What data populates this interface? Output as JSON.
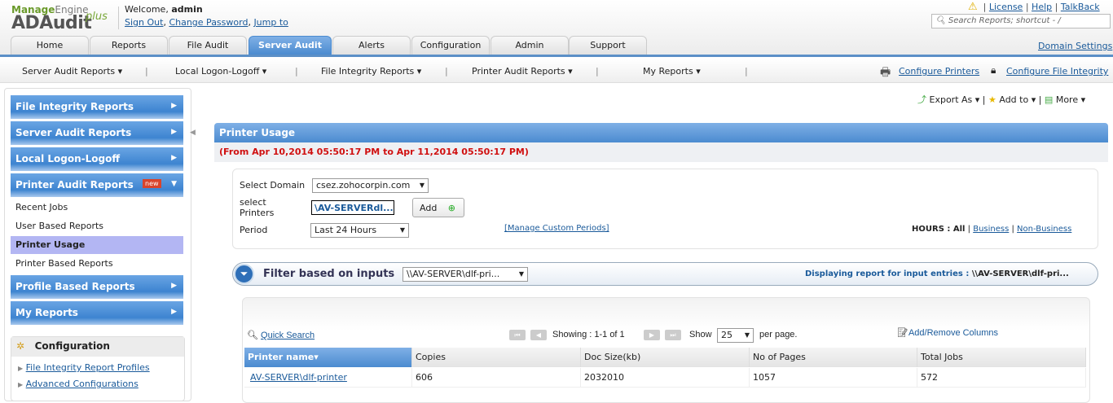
{
  "header": {
    "brand_top_a": "Manage",
    "brand_top_b": "Engine",
    "brand_main": "ADAudit",
    "brand_plus": "plus",
    "welcome_prefix": "Welcome, ",
    "user": "admin",
    "sign_out": "Sign Out",
    "change_password": "Change Password",
    "jump_to": "Jump to",
    "license": "License",
    "help": "Help",
    "talkback": "TalkBack",
    "search_placeholder": "Search Reports; shortcut - /",
    "domain_settings": "Domain Settings"
  },
  "tabs": [
    "Home",
    "Reports",
    "File Audit",
    "Server Audit",
    "Alerts",
    "Configuration",
    "Admin",
    "Support"
  ],
  "subnav": {
    "items": [
      "Server Audit Reports ▾",
      "Local Logon-Logoff ▾",
      "File Integrity Reports ▾",
      "Printer Audit Reports ▾",
      "My Reports ▾"
    ],
    "configure_printers": "Configure Printers",
    "configure_file_integrity": "Configure File Integrity"
  },
  "sidebar": {
    "sections": [
      "File Integrity Reports",
      "Server Audit Reports",
      "Local Logon-Logoff",
      "Printer Audit Reports",
      "Profile Based Reports",
      "My Reports"
    ],
    "new_badge": "new",
    "sub_items": [
      "Recent Jobs",
      "User Based Reports",
      "Printer Usage",
      "Printer Based Reports"
    ],
    "config_title": "Configuration",
    "config_links": [
      "File Integrity Report Profiles",
      "Advanced Configurations"
    ]
  },
  "toolbar": {
    "export": "Export As ▾",
    "add_to": "Add to ▾",
    "more": "More ▾"
  },
  "report": {
    "title": "Printer Usage",
    "date_range": "(From Apr 10,2014 05:50:17 PM to Apr 11,2014 05:50:17 PM)",
    "domain_label": "Select Domain",
    "domain_value": "csez.zohocorpin.com",
    "printers_label": "select Printers",
    "printers_value": "\\AV-SERVERdl...",
    "add_button": "Add",
    "period_label": "Period",
    "period_value": "Last 24 Hours",
    "manage_periods": "[Manage Custom Periods]",
    "hours_label": "HOURS : ",
    "hours_all": "All",
    "hours_business": "Business",
    "hours_nonbusiness": "Non-Business",
    "filter_label": "Filter based on inputs",
    "filter_value": "\\\\AV-SERVER\\dlf-pri...",
    "displaying_label": "Displaying report for input entries : ",
    "displaying_value": "\\\\AV-SERVER\\dlf-pri..."
  },
  "table": {
    "quick_search": "Quick Search",
    "showing": "Showing :  1-1 of 1",
    "show": "Show",
    "page_size": "25",
    "per_page": "per page.",
    "add_remove": "Add/Remove Columns",
    "columns": [
      "Printer name▾",
      "Copies",
      "Doc Size(kb)",
      "No of Pages",
      "Total Jobs"
    ],
    "rows": [
      [
        "AV-SERVER\\dlf-printer",
        "606",
        "2032010",
        "1057",
        "572"
      ]
    ]
  }
}
